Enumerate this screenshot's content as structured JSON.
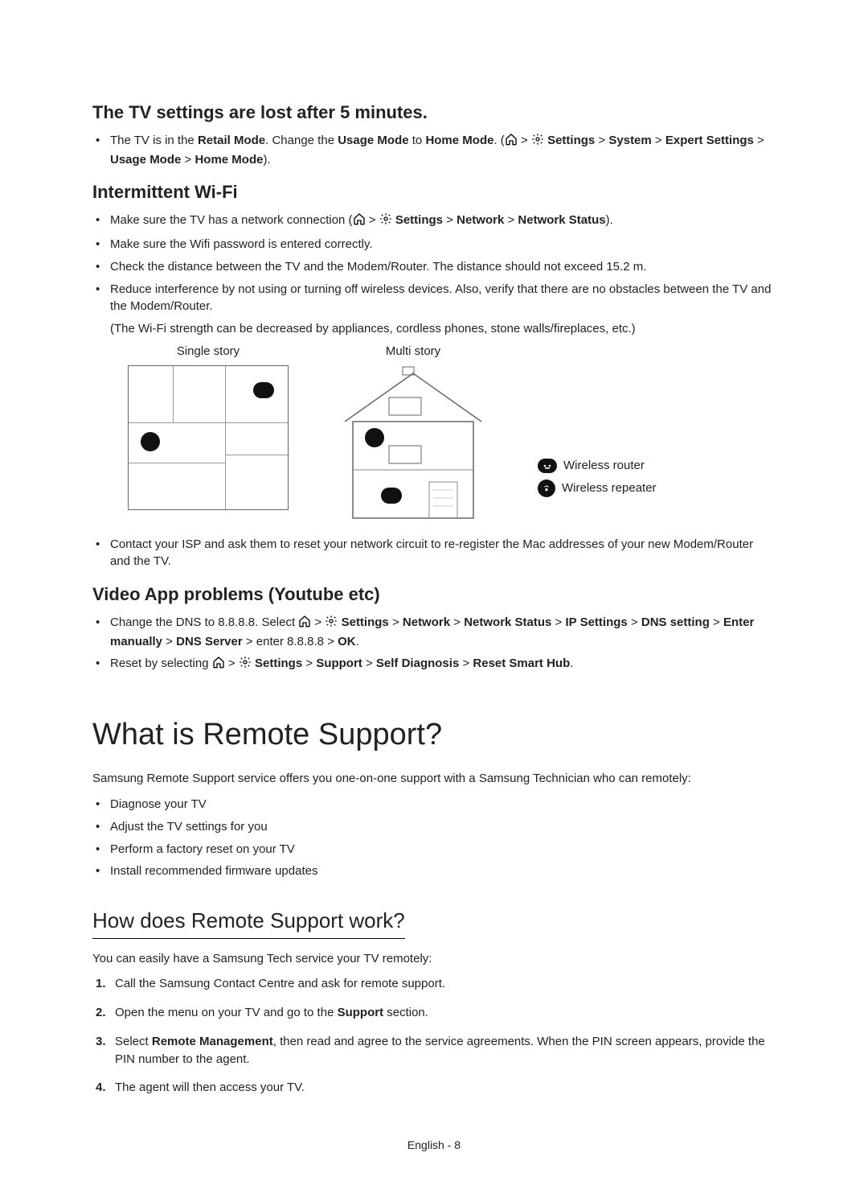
{
  "section_tv_settings": {
    "heading": "The TV settings are lost after 5 minutes.",
    "bullet_prefix": "The TV is in the ",
    "bold_retail": "Retail Mode",
    "mid1": ". Change the ",
    "bold_usage": "Usage Mode",
    "mid2": " to ",
    "bold_home": "Home Mode",
    "mid3": ". (",
    "path_settings": "Settings",
    "path_system": "System",
    "path_expert": "Expert Settings",
    "path_usage": "Usage Mode",
    "path_home": "Home Mode",
    "tail": ")."
  },
  "section_wifi": {
    "heading": "Intermittent Wi-Fi",
    "b1_prefix": "Make sure the TV has a network connection (",
    "b1_settings": "Settings",
    "b1_network": "Network",
    "b1_status": "Network Status",
    "b1_tail": ").",
    "b2": "Make sure the Wifi password is entered correctly.",
    "b3": "Check the distance between the TV and the Modem/Router. The distance should not exceed 15.2 m.",
    "b4": "Reduce interference by not using or turning off wireless devices. Also, verify that there are no obstacles between the TV and the Modem/Router.",
    "b4_note": "(The Wi-Fi strength can be decreased by appliances, cordless phones, stone walls/fireplaces, etc.)",
    "diag_single": "Single story",
    "diag_multi": "Multi story",
    "legend_router": "Wireless router",
    "legend_repeater": "Wireless repeater",
    "b5": "Contact your ISP and ask them to reset your network circuit to re-register the Mac addresses of your new Modem/Router and the TV."
  },
  "section_video": {
    "heading": "Video App problems (Youtube etc)",
    "b1_pre": "Change the DNS to 8.8.8.8. Select ",
    "p_settings": "Settings",
    "p_network": "Network",
    "p_status": "Network Status",
    "p_ip": "IP Settings",
    "p_dns": "DNS setting",
    "p_enter": "Enter manually",
    "p_server": "DNS Server",
    "p_value": "enter 8.8.8.8",
    "p_ok": "OK",
    "b1_tail": ".",
    "b2_pre": "Reset by selecting ",
    "p_support": "Support",
    "p_self": "Self Diagnosis",
    "p_reset": "Reset Smart Hub",
    "b2_tail": "."
  },
  "section_remote": {
    "heading": "What is Remote Support?",
    "intro": "Samsung Remote Support service offers you one-on-one support with a Samsung Technician who can remotely:",
    "b1": "Diagnose your TV",
    "b2": "Adjust the TV settings for you",
    "b3": "Perform a factory reset on your TV",
    "b4": "Install recommended firmware updates"
  },
  "section_how": {
    "heading": "How does Remote Support work?",
    "intro": "You can easily have a Samsung Tech service your TV remotely:",
    "s1": "Call the Samsung Contact Centre and ask for remote support.",
    "s2_pre": "Open the menu on your TV and go to the ",
    "s2_bold": "Support",
    "s2_post": " section.",
    "s3_pre": "Select ",
    "s3_bold": "Remote Management",
    "s3_post": ", then read and agree to the service agreements. When the PIN screen appears, provide the PIN number to the agent.",
    "s4": "The agent will then access your TV."
  },
  "footer": "English - 8",
  "glyph": {
    "arrow": " > "
  }
}
